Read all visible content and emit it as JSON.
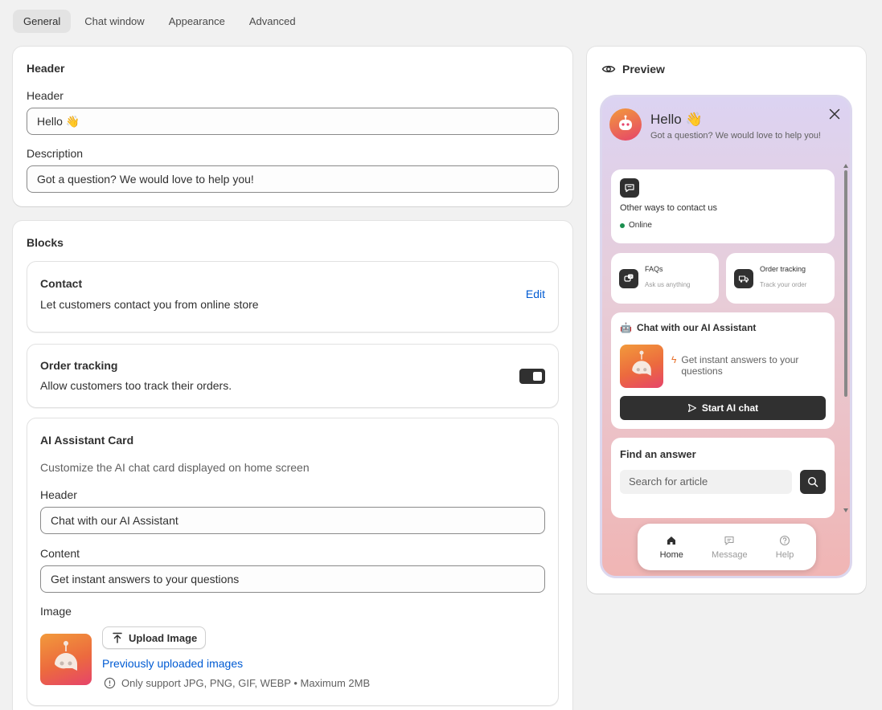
{
  "tabs": [
    "General",
    "Chat window",
    "Appearance",
    "Advanced"
  ],
  "header_section": {
    "title": "Header",
    "header_label": "Header",
    "header_value": "Hello 👋",
    "description_label": "Description",
    "description_value": "Got a question? We would love to help you!"
  },
  "blocks": {
    "title": "Blocks",
    "contact": {
      "title": "Contact",
      "description": "Let customers contact you from online store",
      "edit_label": "Edit"
    },
    "order_tracking": {
      "title": "Order tracking",
      "description": "Allow customers too track their orders.",
      "enabled": true
    },
    "ai_card": {
      "title": "AI Assistant Card",
      "description": "Customize the AI chat card displayed on home screen",
      "header_label": "Header",
      "header_value": "Chat with our AI Assistant",
      "content_label": "Content",
      "content_value": "Get instant answers to your questions",
      "image_label": "Image",
      "upload_label": "Upload Image",
      "previous_link": "Previously uploaded images",
      "hint": "Only support JPG, PNG, GIF, WEBP • Maximum 2MB"
    }
  },
  "preview": {
    "title": "Preview",
    "greeting": "Hello 👋",
    "subtitle": "Got a question? We would love to help you!",
    "contact_card": {
      "title": "Other ways to contact us",
      "status": "Online",
      "status_color": "#1a8f4e"
    },
    "faqs": {
      "title": "FAQs",
      "subtitle": "Ask us anything"
    },
    "order_tracking": {
      "title": "Order tracking",
      "subtitle": "Track your order"
    },
    "ai_card": {
      "title": "Chat with our AI Assistant",
      "content": "Get instant answers to your questions",
      "button": "Start AI chat"
    },
    "find_answer": {
      "title": "Find an answer",
      "placeholder": "Search for article"
    },
    "nav": [
      "Home",
      "Message",
      "Help"
    ]
  },
  "colors": {
    "accent_link": "#005bd3",
    "dark": "#303030",
    "gradient_top": "#dcd3f2",
    "gradient_bottom": "#f0b5b4"
  }
}
